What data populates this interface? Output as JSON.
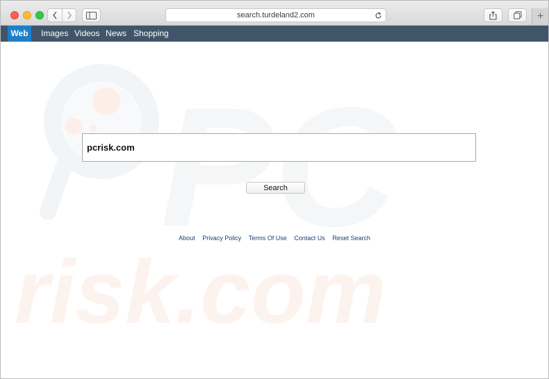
{
  "browser": {
    "url": "search.turdeland2.com",
    "new_tab_label": "+"
  },
  "nav": {
    "items": [
      {
        "label": "Web",
        "active": true
      },
      {
        "label": "Images",
        "active": false
      },
      {
        "label": "Videos",
        "active": false
      },
      {
        "label": "News",
        "active": false
      },
      {
        "label": "Shopping",
        "active": false
      }
    ]
  },
  "search": {
    "query": "pcrisk.com",
    "button_label": "Search"
  },
  "footer": {
    "links": [
      "About",
      "Privacy Policy",
      "Terms Of Use",
      "Contact Us",
      "Reset Search"
    ]
  },
  "watermark": {
    "text_top": "PC",
    "text_bottom": "risk.com"
  },
  "colors": {
    "nav_bg": "#405569",
    "nav_active": "#1f7ec8",
    "link": "#1d3b77"
  }
}
